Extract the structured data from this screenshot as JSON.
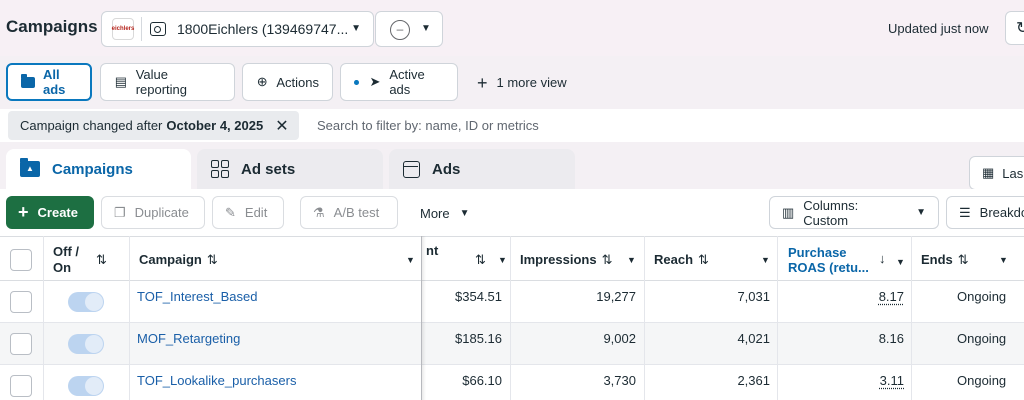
{
  "header": {
    "title": "Campaigns",
    "account_name": "1800Eichlers (139469747...",
    "account_logo_text": "eichlers",
    "status_symbol": "–",
    "updated_text": "Updated just now"
  },
  "views": {
    "all_ads": "All ads",
    "value_reporting": "Value reporting",
    "actions": "Actions",
    "active_ads": "Active ads",
    "more_view": "1 more view"
  },
  "filter": {
    "chip_prefix": "Campaign changed after",
    "chip_value": "October 4, 2025",
    "search_placeholder": "Search to filter by: name, ID or metrics"
  },
  "tabs": {
    "campaigns": "Campaigns",
    "ad_sets": "Ad sets",
    "ads": "Ads",
    "date_range": "Las"
  },
  "toolbar": {
    "create": "Create",
    "duplicate": "Duplicate",
    "edit": "Edit",
    "ab_test": "A/B test",
    "more": "More",
    "columns": "Columns: Custom",
    "breakdown": "Breakdo"
  },
  "table": {
    "headers": {
      "off_on_line1": "Off /",
      "off_on_line2": "On",
      "campaign": "Campaign",
      "amount_spent_fragment": "nt",
      "impressions": "Impressions",
      "reach": "Reach",
      "roas_line1": "Purchase",
      "roas_line2": "ROAS (retu...",
      "ends": "Ends"
    },
    "rows": [
      {
        "campaign": "TOF_Interest_Based",
        "spent": "$354.51",
        "impressions": "19,277",
        "reach": "7,031",
        "roas": "8.17",
        "ends": "Ongoing"
      },
      {
        "campaign": "MOF_Retargeting",
        "spent": "$185.16",
        "impressions": "9,002",
        "reach": "4,021",
        "roas": "8.16",
        "ends": "Ongoing"
      },
      {
        "campaign": "TOF_Lookalike_purchasers",
        "spent": "$66.10",
        "impressions": "3,730",
        "reach": "2,361",
        "roas": "3.11",
        "ends": "Ongoing"
      }
    ]
  },
  "colors": {
    "accent_blue": "#0a66a8",
    "create_green": "#1d6f42",
    "link_blue": "#1a5fa8"
  }
}
